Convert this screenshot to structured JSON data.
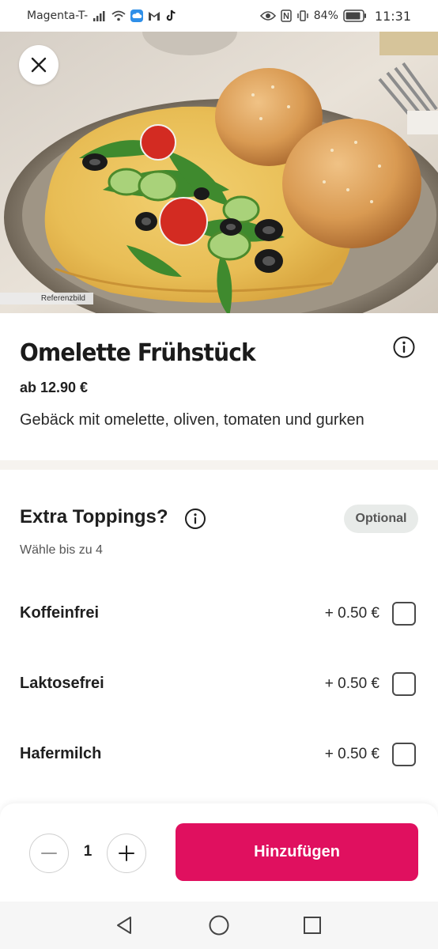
{
  "status_bar": {
    "carrier": "Magenta-T-",
    "battery": "84%",
    "time": "11:31"
  },
  "hero": {
    "reference_label": "Referenzbild"
  },
  "product": {
    "title": "Omelette Frühstück",
    "price": "ab 12.90 €",
    "description": "Gebäck mit omelette, oliven, tomaten und gurken"
  },
  "toppings": {
    "title": "Extra Toppings?",
    "badge": "Optional",
    "subtitle": "Wähle bis zu 4",
    "options": [
      {
        "name": "Koffeinfrei",
        "price": "+ 0.50 €",
        "checked": false
      },
      {
        "name": "Laktosefrei",
        "price": "+ 0.50 €",
        "checked": false
      },
      {
        "name": "Hafermilch",
        "price": "+ 0.50 €",
        "checked": false
      }
    ]
  },
  "cart": {
    "quantity": "1",
    "add_label": "Hinzufügen"
  },
  "colors": {
    "accent": "#e0105f",
    "badge_bg": "#e8ebe9"
  },
  "icons": [
    "close-icon",
    "info-icon",
    "minus-icon",
    "plus-icon",
    "back-icon",
    "home-icon",
    "recents-icon"
  ]
}
